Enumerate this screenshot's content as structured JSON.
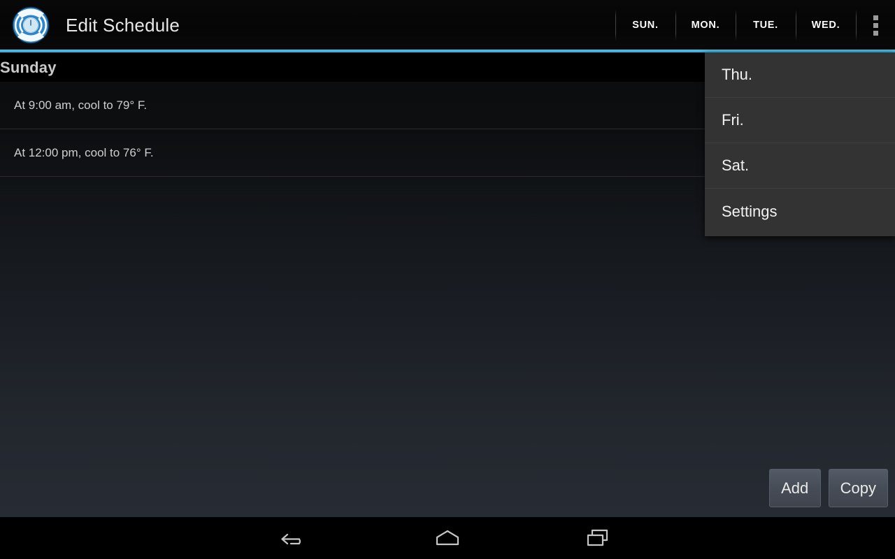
{
  "app": {
    "title": "Edit Schedule",
    "icon": "thermostat-dial-icon"
  },
  "action_bar": {
    "tabs": [
      {
        "label": "SUN.",
        "name": "tab-sunday"
      },
      {
        "label": "MON.",
        "name": "tab-monday"
      },
      {
        "label": "TUE.",
        "name": "tab-tuesday"
      },
      {
        "label": "WED.",
        "name": "tab-wednesday"
      }
    ],
    "overflow_icon": "overflow-menu-icon",
    "accent_color": "#33b5e5"
  },
  "overflow_menu": {
    "open": true,
    "items": [
      {
        "label": "Thu.",
        "name": "menu-item-thursday"
      },
      {
        "label": "Fri.",
        "name": "menu-item-friday"
      },
      {
        "label": "Sat.",
        "name": "menu-item-saturday"
      },
      {
        "label": "Settings",
        "name": "menu-item-settings"
      }
    ]
  },
  "content": {
    "day_header": "Sunday",
    "schedule_rows": [
      {
        "text": "At 9:00 am, cool to 79° F."
      },
      {
        "text": "At 12:00 pm, cool to 76° F."
      }
    ]
  },
  "footer": {
    "add_label": "Add",
    "copy_label": "Copy"
  },
  "nav_bar": {
    "back": "back-icon",
    "home": "home-icon",
    "recents": "recents-icon"
  }
}
